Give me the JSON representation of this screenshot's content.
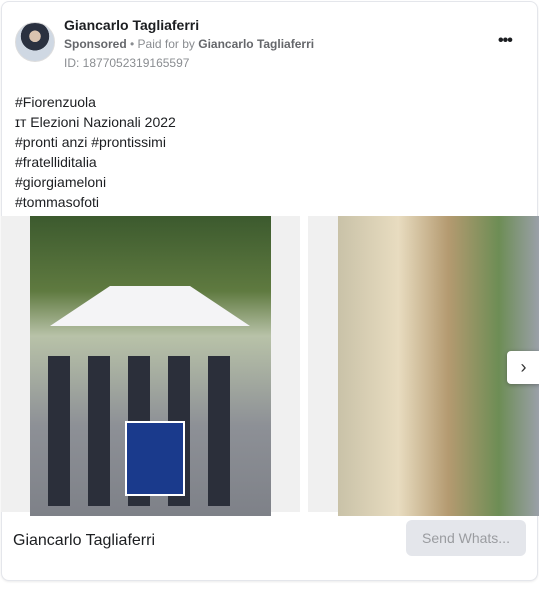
{
  "header": {
    "name": "Giancarlo Tagliaferri",
    "sponsored": "Sponsored",
    "paid_prefix": " • Paid for by ",
    "paid_by": "Giancarlo Tagliaferri",
    "id": "ID: 1877052319165597",
    "more": "•••"
  },
  "body_lines": [
    "#Fiorenzuola",
    "ɪᴛ Elezioni Nazionali 2022",
    "#pronti anzi #prontissimi",
    "#fratelliditalia",
    "#giorgiameloni",
    "#tommasofoti"
  ],
  "carousel": {
    "next": "›"
  },
  "footer": {
    "page_name": "Giancarlo Tagliaferri",
    "cta": "Send Whats..."
  }
}
